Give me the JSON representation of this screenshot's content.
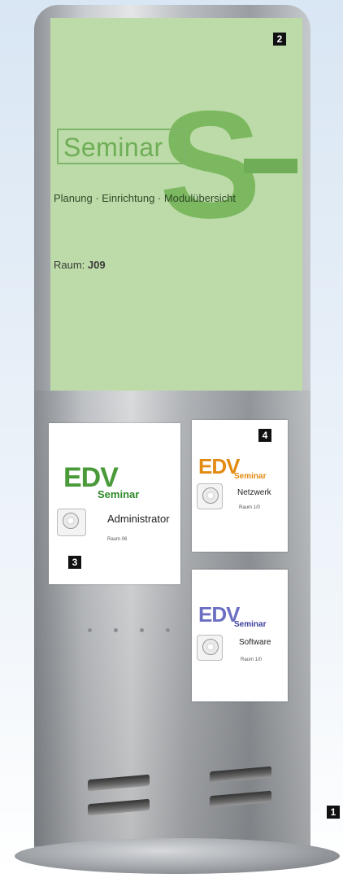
{
  "main_panel": {
    "logo_word": "Seminar",
    "logo_letter": "S",
    "subtitle": "Planung · Einrichtung · Modulübersicht",
    "room_label": "Raum:",
    "room_number": "J09"
  },
  "cards": [
    {
      "edv": "EDV",
      "seminar": "Seminar",
      "label": "Administrator",
      "room": "Raum 06",
      "edv_color": "#4a9a3a",
      "seminar_color": "#2f8a2a"
    },
    {
      "edv": "EDV",
      "seminar": "Seminar",
      "label": "Netzwerk",
      "room": "Raum 1/0",
      "edv_color": "#e38a12",
      "seminar_color": "#e38a12"
    },
    {
      "edv": "EDV",
      "seminar": "Seminar",
      "label": "Software",
      "room": "Raum 1/0",
      "edv_color": "#6a6fc2",
      "seminar_color": "#3b3f9a"
    }
  ],
  "markers": [
    "1",
    "2",
    "3",
    "4"
  ]
}
